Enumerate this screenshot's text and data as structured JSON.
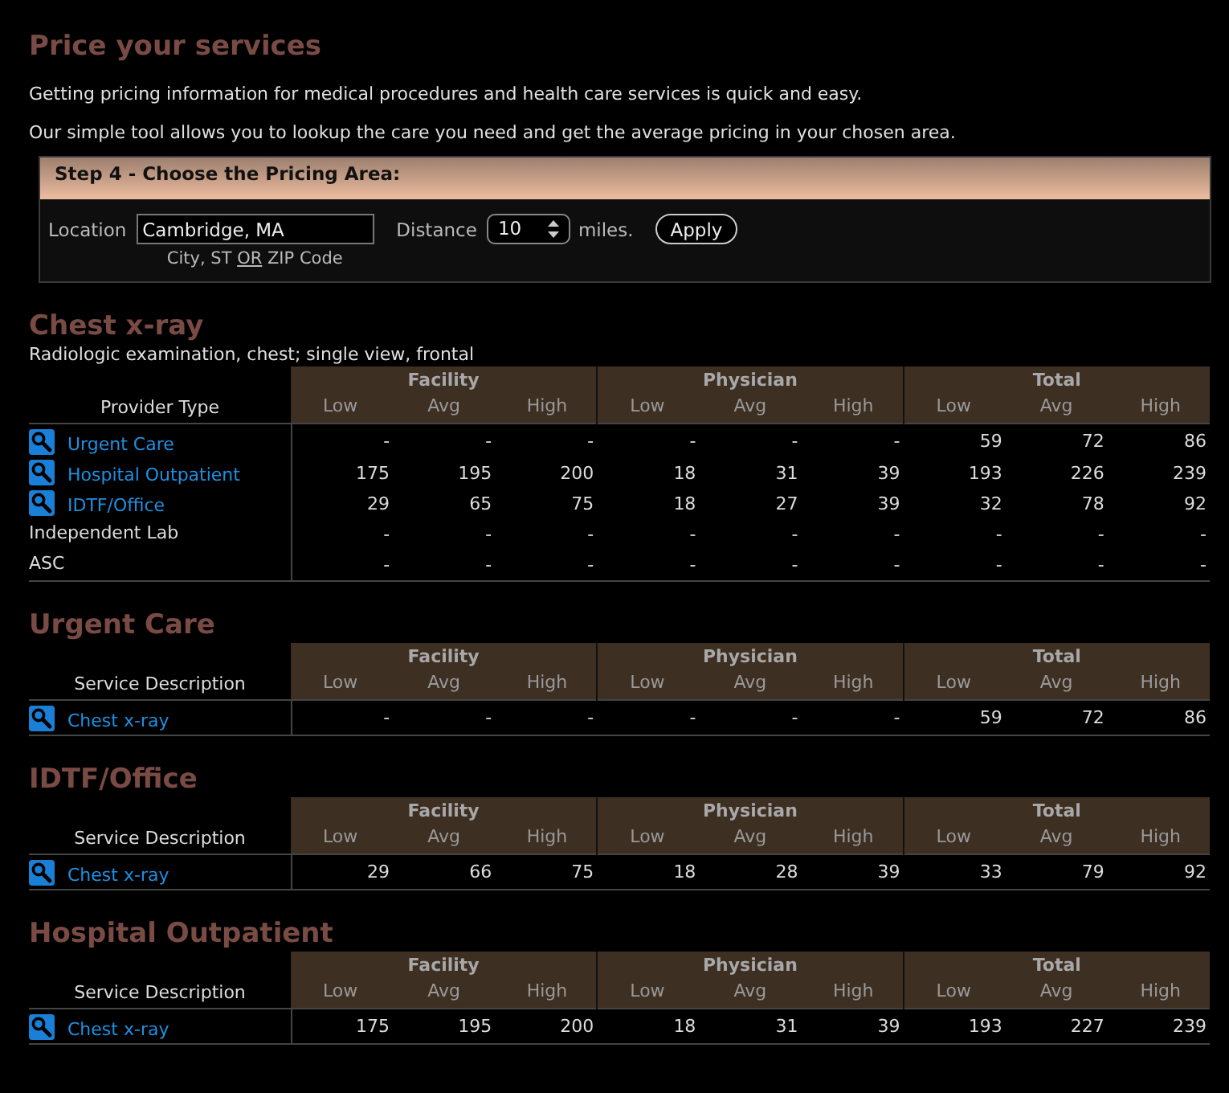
{
  "page": {
    "title": "Price your services",
    "intro": [
      "Getting pricing information for medical procedures and health care services is quick and easy.",
      "Our simple tool allows you to lookup the care you need and get the average pricing in your chosen area."
    ]
  },
  "pricing_area": {
    "heading": "Step 4 - Choose the Pricing Area:",
    "location_label": "Location",
    "location_value": "Cambridge, MA",
    "location_hint": "City, ST **OR** ZIP Code",
    "distance_label": "Distance",
    "distance_value": "10",
    "distance_unit": "miles.",
    "apply_button": "Apply"
  },
  "sections": [
    {
      "title": "Chest x-ray",
      "subtitle": "Radiologic examination, chest; single view, frontal",
      "first_column": "Provider Type",
      "groups": [
        {
          "label": "Facility",
          "columns": [
            "Low",
            "Avg",
            "High"
          ]
        },
        {
          "label": "Physician",
          "columns": [
            "Low",
            "Avg",
            "High"
          ]
        },
        {
          "label": "Total",
          "columns": [
            "Low",
            "Avg",
            "High"
          ]
        }
      ],
      "rows": [
        {
          "kind": "link",
          "label": "Urgent Care",
          "values": [
            "-",
            "-",
            "-",
            "-",
            "-",
            "-",
            "59",
            "72",
            "86"
          ]
        },
        {
          "kind": "link",
          "label": "Hospital Outpatient",
          "values": [
            "175",
            "195",
            "200",
            "18",
            "31",
            "39",
            "193",
            "226",
            "239"
          ]
        },
        {
          "kind": "link",
          "label": "IDTF/Office",
          "values": [
            "29",
            "65",
            "75",
            "18",
            "27",
            "39",
            "32",
            "78",
            "92"
          ]
        },
        {
          "kind": "plain",
          "label": "Independent Lab",
          "values": [
            "-",
            "-",
            "-",
            "-",
            "-",
            "-",
            "-",
            "-",
            "-"
          ]
        },
        {
          "kind": "plain",
          "label": "ASC",
          "values": [
            "-",
            "-",
            "-",
            "-",
            "-",
            "-",
            "-",
            "-",
            "-"
          ]
        }
      ]
    },
    {
      "title": "Urgent Care",
      "first_column": "Service Description",
      "groups": [
        {
          "label": "Facility",
          "columns": [
            "Low",
            "Avg",
            "High"
          ]
        },
        {
          "label": "Physician",
          "columns": [
            "Low",
            "Avg",
            "High"
          ]
        },
        {
          "label": "Total",
          "columns": [
            "Low",
            "Avg",
            "High"
          ]
        }
      ],
      "rows": [
        {
          "kind": "link",
          "label": "Chest x-ray",
          "values": [
            "-",
            "-",
            "-",
            "-",
            "-",
            "-",
            "59",
            "72",
            "86"
          ]
        }
      ]
    },
    {
      "title": "IDTF/Office",
      "first_column": "Service Description",
      "groups": [
        {
          "label": "Facility",
          "columns": [
            "Low",
            "Avg",
            "High"
          ]
        },
        {
          "label": "Physician",
          "columns": [
            "Low",
            "Avg",
            "High"
          ]
        },
        {
          "label": "Total",
          "columns": [
            "Low",
            "Avg",
            "High"
          ]
        }
      ],
      "rows": [
        {
          "kind": "link",
          "label": "Chest x-ray",
          "values": [
            "29",
            "66",
            "75",
            "18",
            "28",
            "39",
            "33",
            "79",
            "92"
          ]
        }
      ]
    },
    {
      "title": "Hospital Outpatient",
      "first_column": "Service Description",
      "groups": [
        {
          "label": "Facility",
          "columns": [
            "Low",
            "Avg",
            "High"
          ]
        },
        {
          "label": "Physician",
          "columns": [
            "Low",
            "Avg",
            "High"
          ]
        },
        {
          "label": "Total",
          "columns": [
            "Low",
            "Avg",
            "High"
          ]
        }
      ],
      "rows": [
        {
          "kind": "link",
          "label": "Chest x-ray",
          "values": [
            "175",
            "195",
            "200",
            "18",
            "31",
            "39",
            "193",
            "227",
            "239"
          ]
        }
      ]
    }
  ]
}
